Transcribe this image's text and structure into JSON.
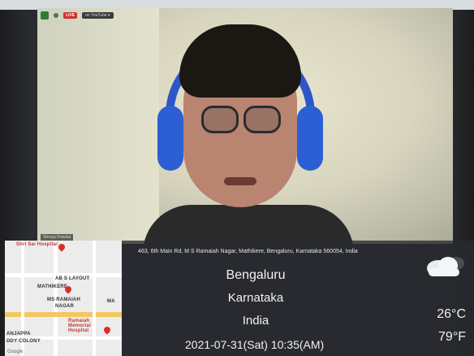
{
  "zoom": {
    "live_badge": "LIVE",
    "live_target": "on YouTube ▾",
    "participant_name": "Shreya Pravina"
  },
  "map": {
    "labels": {
      "hospital": "Shri Sai Hospital",
      "layout": "AB S LAYOUT",
      "mathikere": "MATHIKERE",
      "ms_ramaiah": "MS RAMAIAH",
      "nagar": "NAGAR",
      "memorial": "Ramaiah Memorial Hospital",
      "anjappa": "ANJAPPA",
      "colony": "DDY COLONY",
      "ma": "MA",
      "google": "Google"
    }
  },
  "gps": {
    "address": "463, 6th Main Rd, M S Ramaiah Nagar, Mathikere, Bengaluru, Karnataka 560054, India",
    "city": "Bengaluru",
    "state": "Karnataka",
    "country": "India",
    "datetime": "2021-07-31(Sat)   10:35(AM)",
    "temp_c": "26°C",
    "temp_f": "79°F",
    "weather_icon": "cloud-icon"
  },
  "colors": {
    "headphones": "#2c56c9",
    "live_red": "#d32f2f",
    "overlay": "#282a30"
  }
}
